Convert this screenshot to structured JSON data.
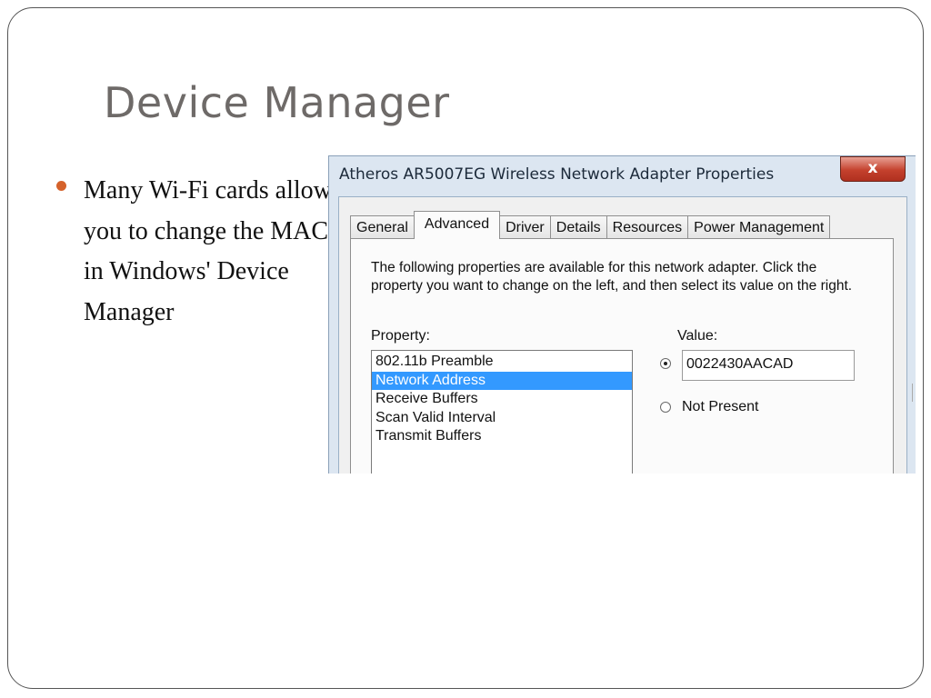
{
  "slide": {
    "title": "Device Manager",
    "bullet": "Many Wi-Fi cards allow you to change the MAC in Windows' Device Manager",
    "bullet_color": "#d5622b"
  },
  "dialog": {
    "title": "Atheros AR5007EG Wireless Network Adapter Properties",
    "close_glyph": "x",
    "tabs": [
      "General",
      "Advanced",
      "Driver",
      "Details",
      "Resources",
      "Power Management"
    ],
    "active_tab": "Advanced",
    "description": "The following properties are available for this network adapter. Click the property you want to change on the left, and then select its value on the right.",
    "property_label": "Property:",
    "value_label": "Value:",
    "properties": [
      "802.11b Preamble",
      "Network Address",
      "Receive Buffers",
      "Scan Valid Interval",
      "Transmit Buffers"
    ],
    "selected_property": "Network Address",
    "value_input": "0022430AACAD",
    "not_present_label": "Not Present",
    "selection_color": "#3399ff",
    "close_color": "#c4412d"
  }
}
